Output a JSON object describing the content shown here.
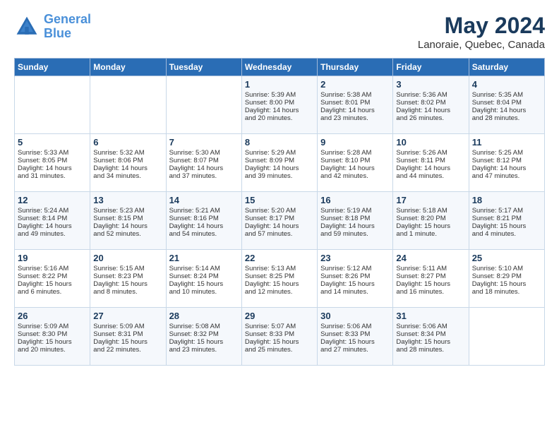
{
  "logo": {
    "line1": "General",
    "line2": "Blue"
  },
  "title": "May 2024",
  "subtitle": "Lanoraie, Quebec, Canada",
  "days_of_week": [
    "Sunday",
    "Monday",
    "Tuesday",
    "Wednesday",
    "Thursday",
    "Friday",
    "Saturday"
  ],
  "weeks": [
    [
      {
        "day": "",
        "info": ""
      },
      {
        "day": "",
        "info": ""
      },
      {
        "day": "",
        "info": ""
      },
      {
        "day": "1",
        "info": "Sunrise: 5:39 AM\nSunset: 8:00 PM\nDaylight: 14 hours\nand 20 minutes."
      },
      {
        "day": "2",
        "info": "Sunrise: 5:38 AM\nSunset: 8:01 PM\nDaylight: 14 hours\nand 23 minutes."
      },
      {
        "day": "3",
        "info": "Sunrise: 5:36 AM\nSunset: 8:02 PM\nDaylight: 14 hours\nand 26 minutes."
      },
      {
        "day": "4",
        "info": "Sunrise: 5:35 AM\nSunset: 8:04 PM\nDaylight: 14 hours\nand 28 minutes."
      }
    ],
    [
      {
        "day": "5",
        "info": "Sunrise: 5:33 AM\nSunset: 8:05 PM\nDaylight: 14 hours\nand 31 minutes."
      },
      {
        "day": "6",
        "info": "Sunrise: 5:32 AM\nSunset: 8:06 PM\nDaylight: 14 hours\nand 34 minutes."
      },
      {
        "day": "7",
        "info": "Sunrise: 5:30 AM\nSunset: 8:07 PM\nDaylight: 14 hours\nand 37 minutes."
      },
      {
        "day": "8",
        "info": "Sunrise: 5:29 AM\nSunset: 8:09 PM\nDaylight: 14 hours\nand 39 minutes."
      },
      {
        "day": "9",
        "info": "Sunrise: 5:28 AM\nSunset: 8:10 PM\nDaylight: 14 hours\nand 42 minutes."
      },
      {
        "day": "10",
        "info": "Sunrise: 5:26 AM\nSunset: 8:11 PM\nDaylight: 14 hours\nand 44 minutes."
      },
      {
        "day": "11",
        "info": "Sunrise: 5:25 AM\nSunset: 8:12 PM\nDaylight: 14 hours\nand 47 minutes."
      }
    ],
    [
      {
        "day": "12",
        "info": "Sunrise: 5:24 AM\nSunset: 8:14 PM\nDaylight: 14 hours\nand 49 minutes."
      },
      {
        "day": "13",
        "info": "Sunrise: 5:23 AM\nSunset: 8:15 PM\nDaylight: 14 hours\nand 52 minutes."
      },
      {
        "day": "14",
        "info": "Sunrise: 5:21 AM\nSunset: 8:16 PM\nDaylight: 14 hours\nand 54 minutes."
      },
      {
        "day": "15",
        "info": "Sunrise: 5:20 AM\nSunset: 8:17 PM\nDaylight: 14 hours\nand 57 minutes."
      },
      {
        "day": "16",
        "info": "Sunrise: 5:19 AM\nSunset: 8:18 PM\nDaylight: 14 hours\nand 59 minutes."
      },
      {
        "day": "17",
        "info": "Sunrise: 5:18 AM\nSunset: 8:20 PM\nDaylight: 15 hours\nand 1 minute."
      },
      {
        "day": "18",
        "info": "Sunrise: 5:17 AM\nSunset: 8:21 PM\nDaylight: 15 hours\nand 4 minutes."
      }
    ],
    [
      {
        "day": "19",
        "info": "Sunrise: 5:16 AM\nSunset: 8:22 PM\nDaylight: 15 hours\nand 6 minutes."
      },
      {
        "day": "20",
        "info": "Sunrise: 5:15 AM\nSunset: 8:23 PM\nDaylight: 15 hours\nand 8 minutes."
      },
      {
        "day": "21",
        "info": "Sunrise: 5:14 AM\nSunset: 8:24 PM\nDaylight: 15 hours\nand 10 minutes."
      },
      {
        "day": "22",
        "info": "Sunrise: 5:13 AM\nSunset: 8:25 PM\nDaylight: 15 hours\nand 12 minutes."
      },
      {
        "day": "23",
        "info": "Sunrise: 5:12 AM\nSunset: 8:26 PM\nDaylight: 15 hours\nand 14 minutes."
      },
      {
        "day": "24",
        "info": "Sunrise: 5:11 AM\nSunset: 8:27 PM\nDaylight: 15 hours\nand 16 minutes."
      },
      {
        "day": "25",
        "info": "Sunrise: 5:10 AM\nSunset: 8:29 PM\nDaylight: 15 hours\nand 18 minutes."
      }
    ],
    [
      {
        "day": "26",
        "info": "Sunrise: 5:09 AM\nSunset: 8:30 PM\nDaylight: 15 hours\nand 20 minutes."
      },
      {
        "day": "27",
        "info": "Sunrise: 5:09 AM\nSunset: 8:31 PM\nDaylight: 15 hours\nand 22 minutes."
      },
      {
        "day": "28",
        "info": "Sunrise: 5:08 AM\nSunset: 8:32 PM\nDaylight: 15 hours\nand 23 minutes."
      },
      {
        "day": "29",
        "info": "Sunrise: 5:07 AM\nSunset: 8:33 PM\nDaylight: 15 hours\nand 25 minutes."
      },
      {
        "day": "30",
        "info": "Sunrise: 5:06 AM\nSunset: 8:33 PM\nDaylight: 15 hours\nand 27 minutes."
      },
      {
        "day": "31",
        "info": "Sunrise: 5:06 AM\nSunset: 8:34 PM\nDaylight: 15 hours\nand 28 minutes."
      },
      {
        "day": "",
        "info": ""
      }
    ]
  ]
}
